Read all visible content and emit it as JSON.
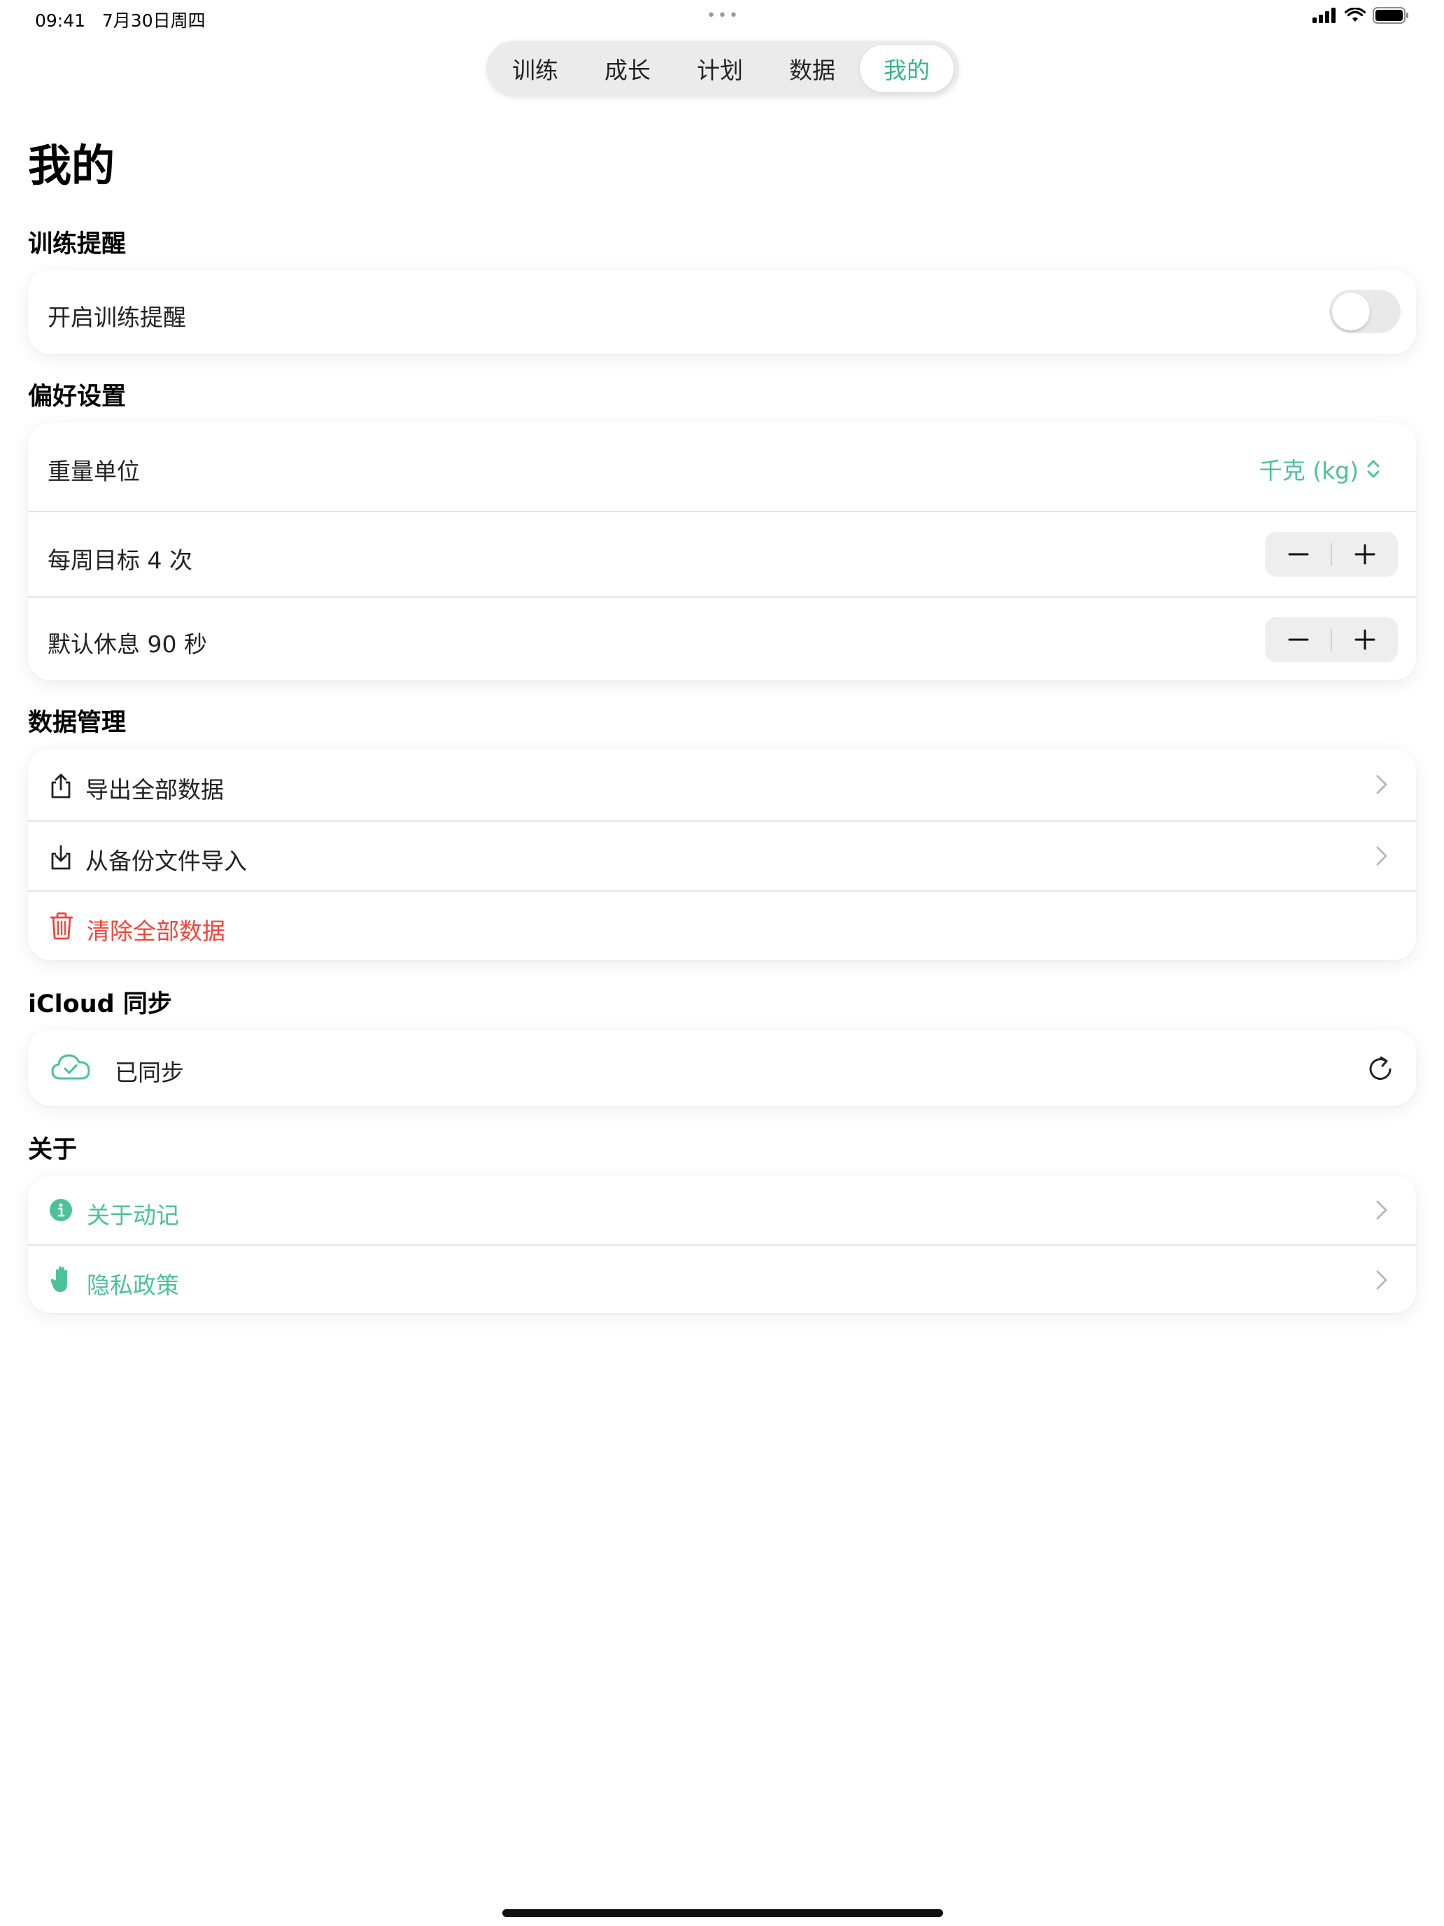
{
  "status_bar": {
    "time": "09:41",
    "date": "7月30日周四",
    "dots": "•••"
  },
  "tabs": [
    {
      "label": "训练",
      "active": false
    },
    {
      "label": "成长",
      "active": false
    },
    {
      "label": "计划",
      "active": false
    },
    {
      "label": "数据",
      "active": false
    },
    {
      "label": "我的",
      "active": true
    }
  ],
  "page_title": "我的",
  "sections": {
    "reminder": {
      "title": "训练提醒",
      "toggle_label": "开启训练提醒",
      "toggle_on": false
    },
    "preferences": {
      "title": "偏好设置",
      "weight_unit_label": "重量单位",
      "weight_unit_value": "千克 (kg)",
      "weekly_goal_label": "每周目标 4 次",
      "rest_label": "默认休息 90 秒"
    },
    "data_management": {
      "title": "数据管理",
      "export_label": "导出全部数据",
      "import_label": "从备份文件导入",
      "clear_label": "清除全部数据"
    },
    "icloud": {
      "title": "iCloud 同步",
      "status_label": "已同步"
    },
    "about": {
      "title": "关于",
      "about_label": "关于动记",
      "privacy_label": "隐私政策"
    }
  },
  "colors": {
    "accent": "#4cc29a",
    "destructive": "#f0453a",
    "secondary_text": "#8e8e93"
  },
  "icons": {
    "export": "square-arrow-up-icon",
    "import": "square-arrow-down-icon",
    "clear": "trash-icon",
    "icloud": "icloud-check-icon",
    "refresh": "refresh-icon",
    "about": "info-circle-icon",
    "privacy": "hand-raised-icon",
    "chevron": "chevron-right-icon",
    "updown": "chevron-up-down-icon"
  }
}
